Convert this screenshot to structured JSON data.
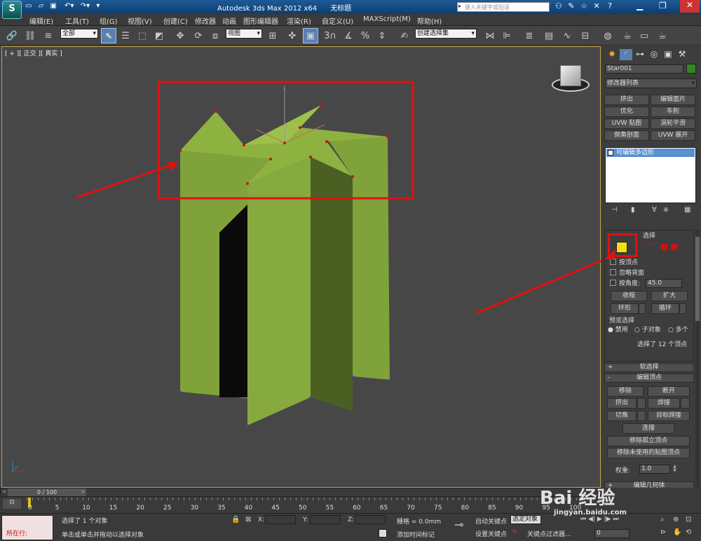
{
  "title": {
    "app": "Autodesk 3ds Max  2012 x64",
    "doc": "无标题",
    "search_placeholder": "键入关键字或短语"
  },
  "menu": [
    "编辑(E)",
    "工具(T)",
    "组(G)",
    "视图(V)",
    "创建(C)",
    "修改器",
    "动画",
    "图形编辑器",
    "渲染(R)",
    "自定义(U)",
    "MAXScript(M)",
    "帮助(H)"
  ],
  "toolbar": {
    "filter": "全部",
    "ref_coord": "视图",
    "named_set": "创建选择集",
    "snap_3": "3",
    "snap_percent": "%",
    "abc": "ABC"
  },
  "viewport": {
    "label": "[ + ][ 正交 ][ 真实 ]"
  },
  "colors": {
    "accent": "#5a7fb0",
    "object": "#7fa23a",
    "annotation": "#e01010",
    "viewport_border": "#c7a34a"
  },
  "panel": {
    "object_name": "Star001",
    "modifier_list": "修改器列表",
    "mod_buttons": [
      "挤出",
      "编辑面片",
      "优化",
      "车削",
      "UVW 贴图",
      "涡轮平滑",
      "倒角剖面",
      "UVW 展开"
    ],
    "stack_item": "可编辑多边形",
    "selection": {
      "title": "选择",
      "by_vertex": "按顶点",
      "ignore_backface": "忽略背面",
      "by_angle": "按角度:",
      "angle_value": "45.0",
      "shrink": "收缩",
      "grow": "扩大",
      "ring": "环形",
      "loop": "循环",
      "preview_title": "预览选择",
      "preview_options": [
        "禁用",
        "子对象",
        "多个"
      ],
      "status": "选择了 12 个顶点"
    },
    "soft_selection": "软选择",
    "edit_vertices": {
      "title": "编辑顶点",
      "remove": "移除",
      "break": "断开",
      "extrude": "挤出",
      "weld": "焊接",
      "chamfer": "切角",
      "target_weld": "目标焊接",
      "connect": "连接",
      "remove_isolated": "移除孤立顶点",
      "remove_unused": "移除未使用的贴图顶点",
      "weight_label": "权重:",
      "weight_value": "1.0"
    },
    "edit_geometry": "编辑几何体"
  },
  "timeline": {
    "frame": "0 / 100",
    "ticks": [
      "0",
      "5",
      "10",
      "15",
      "20",
      "25",
      "30",
      "35",
      "40",
      "45",
      "50",
      "55",
      "60",
      "65",
      "70",
      "75",
      "80",
      "85",
      "90",
      "95",
      "100"
    ]
  },
  "status": {
    "maxscript": "所在行:",
    "prompt1": "选择了 1 个对象",
    "prompt2": "单击或单击并拖动以选择对象",
    "x_label": "X:",
    "y_label": "Y:",
    "z_label": "Z:",
    "grid": "栅格 = 0.0mm",
    "add_time_tag": "添加时间标记",
    "auto_key": "自动关键点",
    "set_key": "设置关键点",
    "selected_obj": "选定对象",
    "key_filters": "关键点过滤器...",
    "frame_value": "0"
  },
  "watermark": {
    "brand": "Bai 经验",
    "url": "jingyan.baidu.com"
  }
}
